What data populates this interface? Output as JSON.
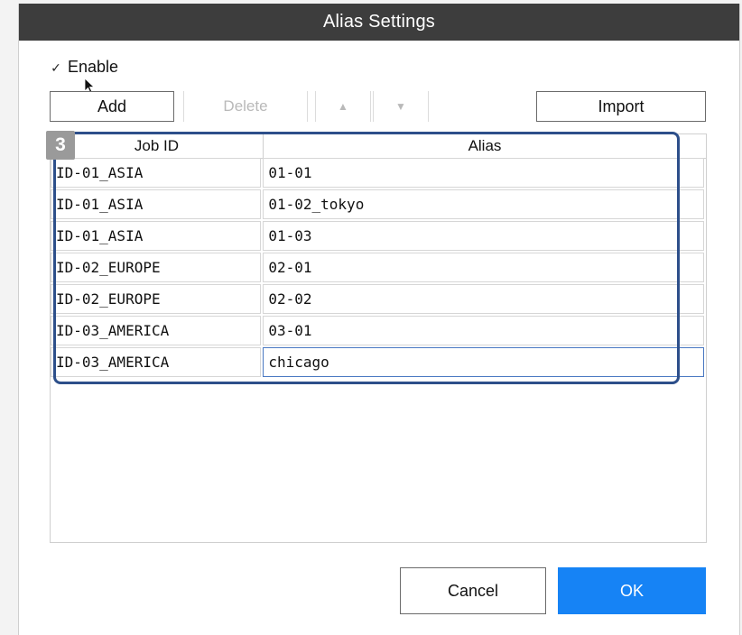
{
  "window": {
    "title": "Alias Settings"
  },
  "enable": {
    "label": "Enable",
    "checked": true
  },
  "toolbar": {
    "add_label": "Add",
    "delete_label": "Delete",
    "import_label": "Import"
  },
  "annotation": {
    "badge": "3"
  },
  "table": {
    "headers": {
      "job_id": "Job ID",
      "alias": "Alias"
    },
    "rows": [
      {
        "job_id": "ID-01_ASIA",
        "alias": "01-01"
      },
      {
        "job_id": "ID-01_ASIA",
        "alias": "01-02_tokyo"
      },
      {
        "job_id": "ID-01_ASIA",
        "alias": "01-03"
      },
      {
        "job_id": "ID-02_EUROPE",
        "alias": "02-01"
      },
      {
        "job_id": "ID-02_EUROPE",
        "alias": "02-02"
      },
      {
        "job_id": "ID-03_AMERICA",
        "alias": "03-01"
      },
      {
        "job_id": "ID-03_AMERICA",
        "alias": "chicago"
      }
    ]
  },
  "footer": {
    "cancel_label": "Cancel",
    "ok_label": "OK"
  },
  "colors": {
    "titlebar": "#3d3d3d",
    "ok_button": "#1683f5",
    "highlight_border": "#2d4f8a",
    "badge": "#9a9a9a"
  }
}
